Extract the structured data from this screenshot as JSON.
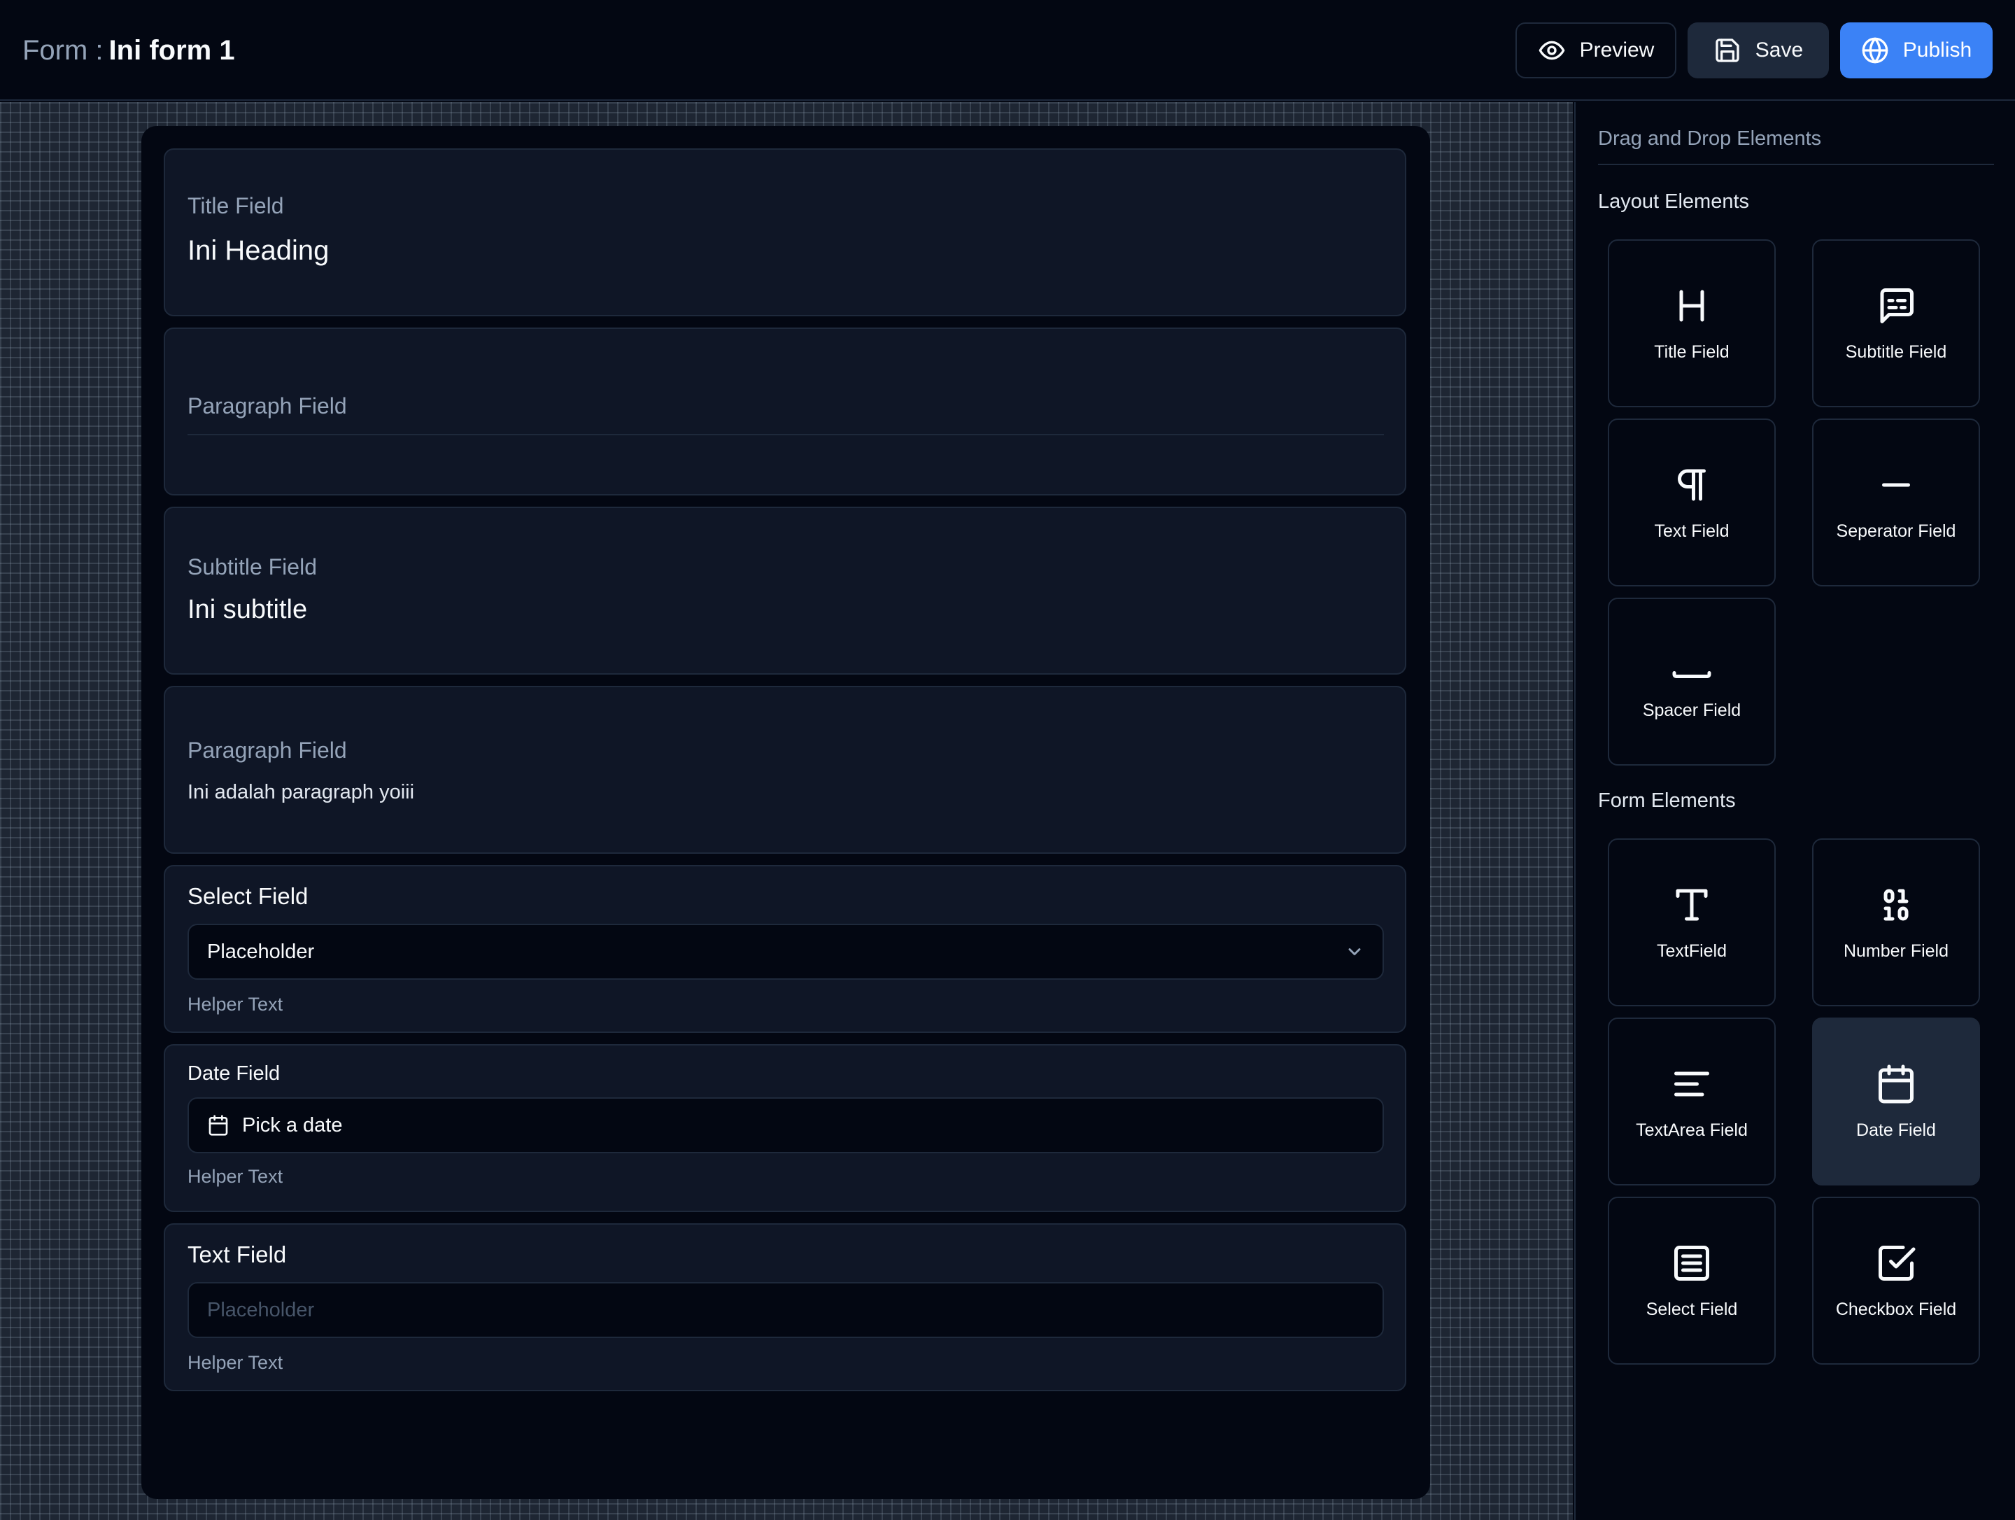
{
  "header": {
    "form_label": "Form :",
    "form_name": "Ini form 1",
    "preview_label": "Preview",
    "save_label": "Save",
    "publish_label": "Publish"
  },
  "form": {
    "title_field": {
      "label": "Title Field",
      "value": "Ini Heading"
    },
    "paragraph_field_1": {
      "label": "Paragraph Field"
    },
    "subtitle_field": {
      "label": "Subtitle Field",
      "value": "Ini subtitle"
    },
    "paragraph_field_2": {
      "label": "Paragraph Field",
      "value": "Ini adalah paragraph yoiii"
    },
    "select_field": {
      "label": "Select Field",
      "value": "Placeholder",
      "helper": "Helper Text"
    },
    "date_field": {
      "label": "Date Field",
      "value": "Pick a date",
      "helper": "Helper Text"
    },
    "text_field": {
      "label": "Text Field",
      "placeholder": "Placeholder",
      "helper": "Helper Text"
    }
  },
  "sidebar": {
    "title": "Drag and Drop Elements",
    "layout_section": "Layout Elements",
    "layout_items": [
      {
        "label": "Title Field",
        "icon": "heading-icon"
      },
      {
        "label": "Subtitle Field",
        "icon": "message-text-icon"
      },
      {
        "label": "Text Field",
        "icon": "pilcrow-icon"
      },
      {
        "label": "Seperator Field",
        "icon": "minus-icon"
      },
      {
        "label": "Spacer Field",
        "icon": "space-icon"
      }
    ],
    "form_section": "Form Elements",
    "form_items": [
      {
        "label": "TextField",
        "icon": "type-icon"
      },
      {
        "label": "Number Field",
        "icon": "binary-icon"
      },
      {
        "label": "TextArea Field",
        "icon": "text-lines-icon"
      },
      {
        "label": "Date Field",
        "icon": "calendar-icon",
        "active": true
      },
      {
        "label": "Select Field",
        "icon": "list-box-icon"
      },
      {
        "label": "Checkbox Field",
        "icon": "checkbox-icon"
      }
    ]
  },
  "colors": {
    "background": "#030712",
    "border": "#1e293b",
    "accent": "#3b82f6",
    "muted_text": "#94a3b8"
  }
}
